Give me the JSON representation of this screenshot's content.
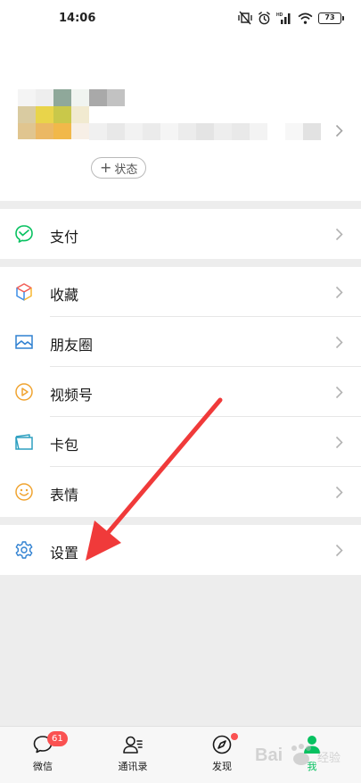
{
  "status_bar": {
    "time": "14:06",
    "battery": "73",
    "network": "HD"
  },
  "profile": {
    "status_button": {
      "plus": "+",
      "label": "状态"
    }
  },
  "menu": {
    "pay": {
      "label": "支付"
    },
    "favorites": {
      "label": "收藏"
    },
    "moments": {
      "label": "朋友圈"
    },
    "channels": {
      "label": "视频号"
    },
    "cards": {
      "label": "卡包"
    },
    "stickers": {
      "label": "表情"
    },
    "settings": {
      "label": "设置"
    }
  },
  "tabs": [
    {
      "label": "微信",
      "badge": "61"
    },
    {
      "label": "通讯录"
    },
    {
      "label": "发现"
    },
    {
      "label": "我"
    }
  ],
  "colors": {
    "accent": "#07c160",
    "badge": "#fa5151",
    "annotation_arrow": "#f03a3a"
  },
  "watermark": {
    "brand": "Bai",
    "suffix": "经验"
  }
}
